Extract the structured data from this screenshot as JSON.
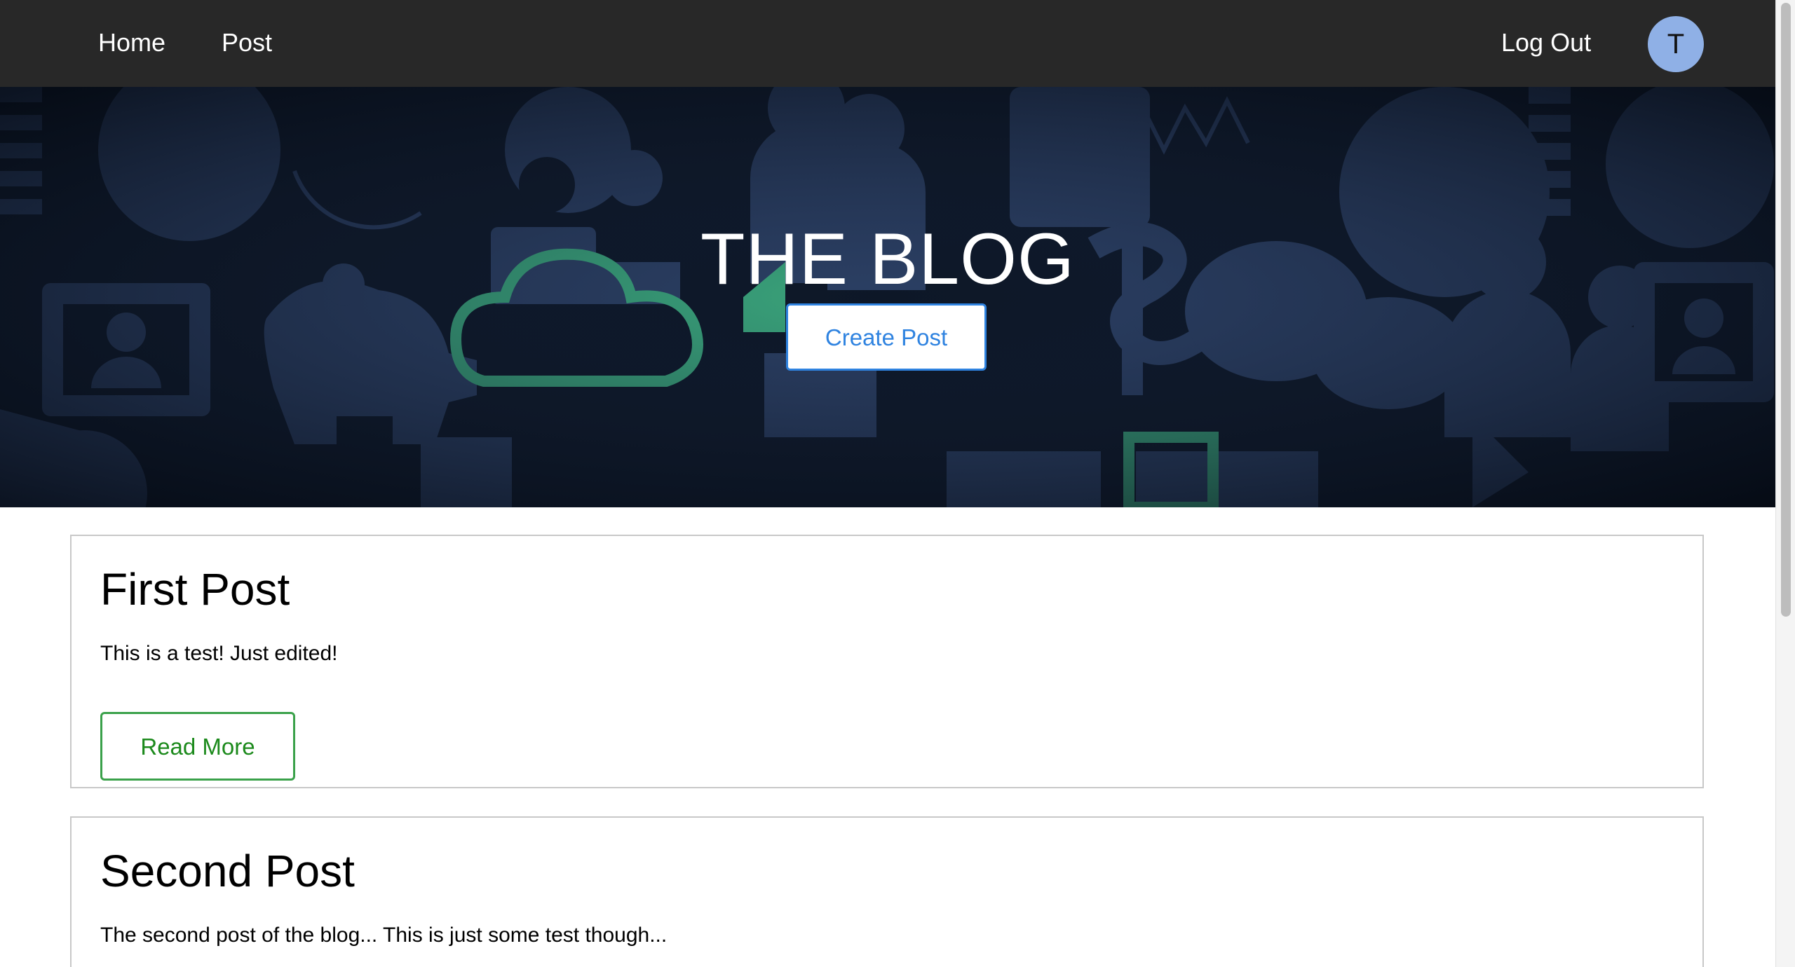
{
  "nav": {
    "home_label": "Home",
    "post_label": "Post",
    "logout_label": "Log Out",
    "avatar_initial": "T"
  },
  "hero": {
    "title": "THE BLOG",
    "create_label": "Create Post"
  },
  "posts": [
    {
      "title": "First Post",
      "body": "This is a test! Just edited!",
      "read_more_label": "Read More"
    },
    {
      "title": "Second Post",
      "body": "The second post of the blog... This is just some test though..."
    }
  ],
  "colors": {
    "navbar_bg": "#282828",
    "avatar_bg": "#8fb0e6",
    "create_button_accent": "#2f83e0",
    "read_more_accent": "#3aa14a",
    "hero_icon_blue": "#2b3f63",
    "hero_icon_green": "#3aa57b"
  }
}
